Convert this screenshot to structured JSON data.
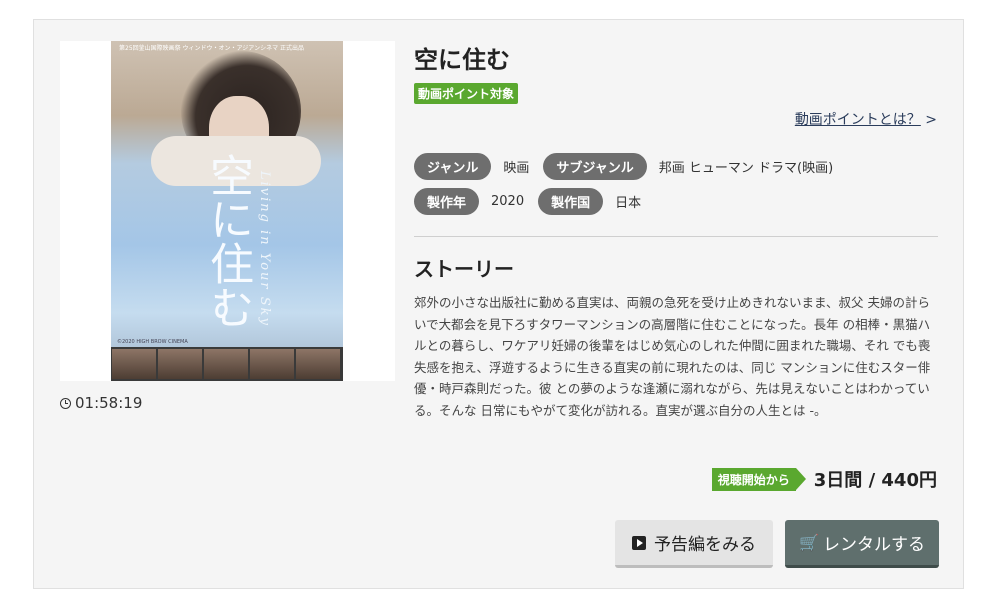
{
  "title": "空に住む",
  "point_badge": "動画ポイント対象",
  "point_link": {
    "label": "動画ポイントとは？",
    "arrow": ">"
  },
  "poster": {
    "top_text": "第25回釜山国際映画祭 ウィンドウ・オン・アジアンシネマ 正式出品",
    "title": "空に住む",
    "subtitle": "Living in Your Sky",
    "credit": "©2020 HIGH BROW CINEMA"
  },
  "duration": "01:58:19",
  "meta": {
    "genre_label": "ジャンル",
    "genre_value": "映画",
    "subgenre_label": "サブジャンル",
    "subgenre_value": "邦画 ヒューマン ドラマ(映画)",
    "year_label": "製作年",
    "year_value": "2020",
    "country_label": "製作国",
    "country_value": "日本"
  },
  "story": {
    "heading": "ストーリー",
    "text": "郊外の小さな出版社に勤める直実は、両親の急死を受け止めきれないまま、叔父 夫婦の計らいで大都会を見下ろすタワーマンションの高層階に住むことになった。長年 の相棒・黒猫ハルとの暮らし、ワケアリ妊婦の後輩をはじめ気心のしれた仲間に囲まれた職場、それ でも喪失感を抱え、浮遊するように生きる直実の前に現れたのは、同じ マンションに住むスター俳優・時戸森則だった。彼 との夢のような逢瀬に溺れながら、先は見えないことはわかっている。そんな 日常にもやがて変化が訪れる。直実が選ぶ自分の人生とは -。"
  },
  "pricing": {
    "tag": "視聴開始から",
    "price": "3日間 / 440円"
  },
  "buttons": {
    "trailer": "予告編をみる",
    "rent": "レンタルする"
  },
  "colors": {
    "green": "#5aa82f",
    "tag_gray": "#6e6e6e",
    "rent_button": "#5f6f6d"
  }
}
